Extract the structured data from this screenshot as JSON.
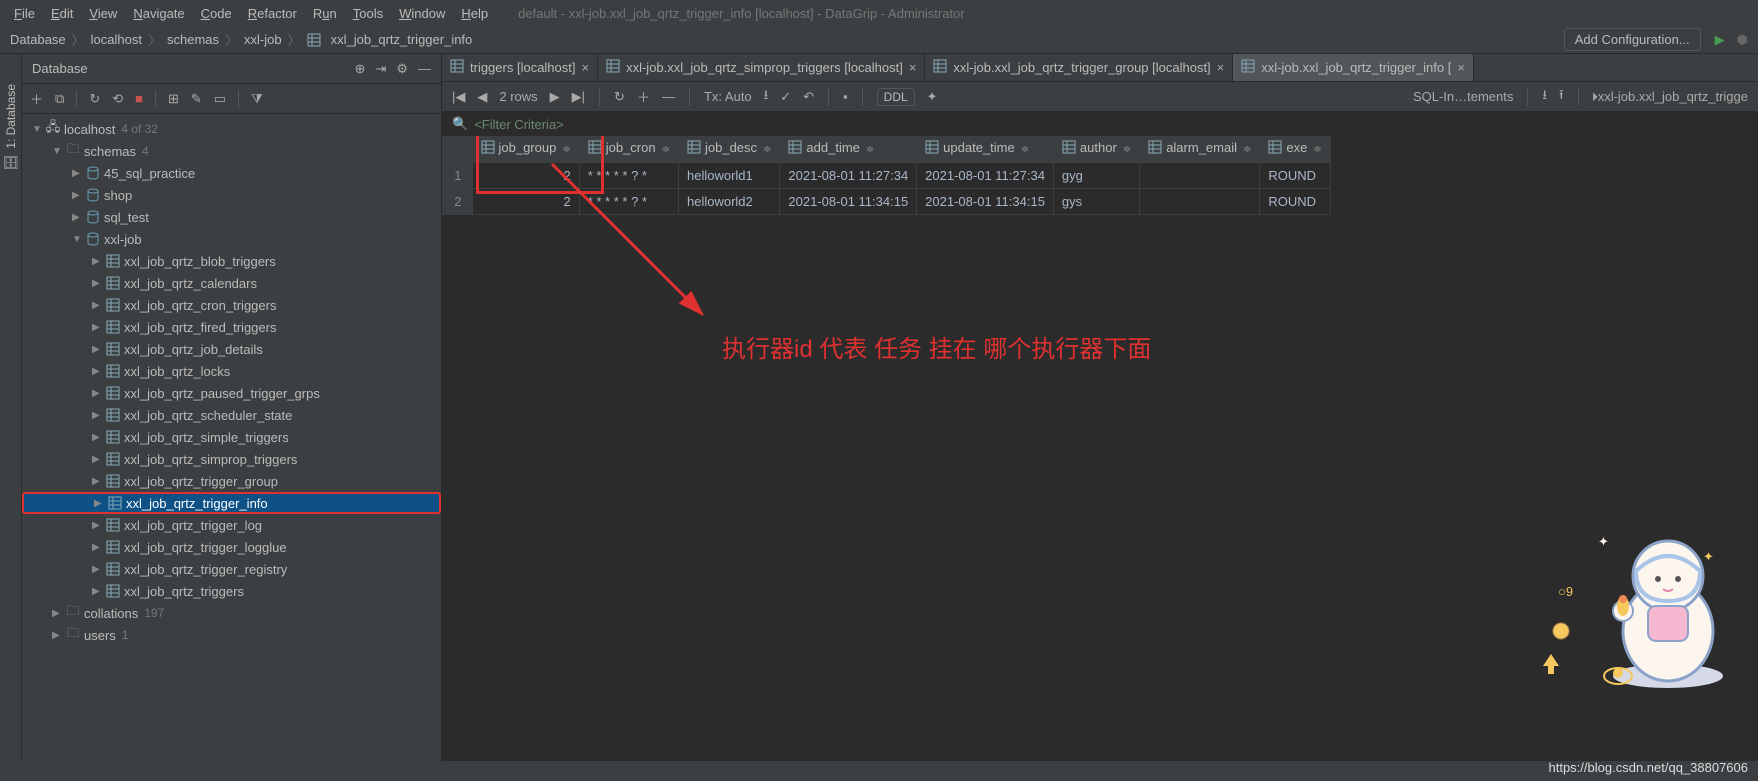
{
  "window_title": "default - xxl-job.xxl_job_qrtz_trigger_info [localhost] - DataGrip - Administrator",
  "menu": [
    "File",
    "Edit",
    "View",
    "Navigate",
    "Code",
    "Refactor",
    "Run",
    "Tools",
    "Window",
    "Help"
  ],
  "breadcrumb": [
    "Database",
    "localhost",
    "schemas",
    "xxl-job",
    "xxl_job_qrtz_trigger_info"
  ],
  "add_config": "Add Configuration...",
  "panel_title": "Database",
  "side_tab": "1: Database",
  "tabs": [
    {
      "label": "triggers [localhost]",
      "active": false
    },
    {
      "label": "xxl-job.xxl_job_qrtz_simprop_triggers [localhost]",
      "active": false
    },
    {
      "label": "xxl-job.xxl_job_qrtz_trigger_group [localhost]",
      "active": false
    },
    {
      "label": "xxl-job.xxl_job_qrtz_trigger_info [",
      "active": true
    }
  ],
  "tree": {
    "root": {
      "label": "localhost",
      "count": "4 of 32"
    },
    "schemas": {
      "label": "schemas",
      "count": "4"
    },
    "dbs": [
      {
        "label": "45_sql_practice",
        "expanded": false
      },
      {
        "label": "shop",
        "expanded": false
      },
      {
        "label": "sql_test",
        "expanded": false
      },
      {
        "label": "xxl-job",
        "expanded": true
      }
    ],
    "tables": [
      "xxl_job_qrtz_blob_triggers",
      "xxl_job_qrtz_calendars",
      "xxl_job_qrtz_cron_triggers",
      "xxl_job_qrtz_fired_triggers",
      "xxl_job_qrtz_job_details",
      "xxl_job_qrtz_locks",
      "xxl_job_qrtz_paused_trigger_grps",
      "xxl_job_qrtz_scheduler_state",
      "xxl_job_qrtz_simple_triggers",
      "xxl_job_qrtz_simprop_triggers",
      "xxl_job_qrtz_trigger_group",
      "xxl_job_qrtz_trigger_info",
      "xxl_job_qrtz_trigger_log",
      "xxl_job_qrtz_trigger_logglue",
      "xxl_job_qrtz_trigger_registry",
      "xxl_job_qrtz_triggers"
    ],
    "selected_table": "xxl_job_qrtz_trigger_info",
    "collations": {
      "label": "collations",
      "count": "197"
    },
    "users": {
      "label": "users",
      "count": "1"
    }
  },
  "grid_toolbar": {
    "rows": "2 rows",
    "tx": "Tx: Auto",
    "ddl": "DDL",
    "sql": "SQL-In…tements",
    "mini_tab": "xxl-job.xxl_job_qrtz_trigge"
  },
  "filter_placeholder": "<Filter Criteria>",
  "columns": [
    "job_group",
    "job_cron",
    "job_desc",
    "add_time",
    "update_time",
    "author",
    "alarm_email",
    "exe"
  ],
  "rows": [
    {
      "num": "1",
      "job_group": "2",
      "job_cron": "* * * * * ? *",
      "job_desc": "helloworld1",
      "add_time": "2021-08-01 11:27:34",
      "update_time": "2021-08-01 11:27:34",
      "author": "gyg",
      "alarm_email": "",
      "exe": "ROUND"
    },
    {
      "num": "2",
      "job_group": "2",
      "job_cron": "* * * * * ? *",
      "job_desc": "helloworld2",
      "add_time": "2021-08-01 11:34:15",
      "update_time": "2021-08-01 11:34:15",
      "author": "gys",
      "alarm_email": "",
      "exe": "ROUND"
    }
  ],
  "annotation": "执行器id 代表 任务 挂在 哪个执行器下面",
  "footer_url": "https://blog.csdn.net/qq_38807606"
}
